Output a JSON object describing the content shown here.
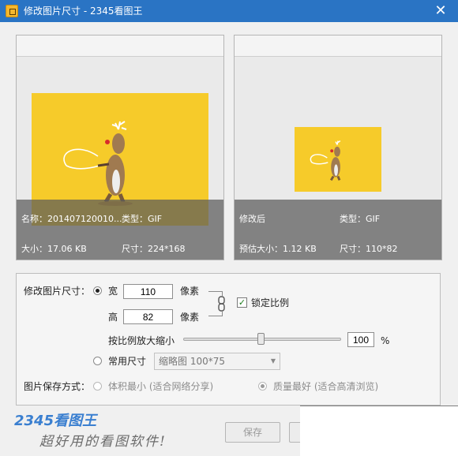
{
  "window": {
    "title": "修改图片尺寸 - 2345看图王",
    "close_symbol": "✕"
  },
  "preview_original": {
    "name_text": "名称：201407120010...",
    "type_text": "类型：GIF",
    "size_text": "大小：17.06 KB",
    "dimensions_text": "尺寸：224*168",
    "image_bg_color": "#f6cb2a"
  },
  "preview_modified": {
    "label_text": "修改后",
    "type_text": "类型：GIF",
    "est_size_text": "预估大小：1.12 KB",
    "dimensions_text": "尺寸：110*82",
    "image_bg_color": "#f6cb2a"
  },
  "settings": {
    "modify_label": "修改图片尺寸：",
    "width_label": "宽",
    "width_value": "110",
    "width_unit": "像素",
    "height_label": "高",
    "height_value": "82",
    "height_unit": "像素",
    "lock_label": "锁定比例",
    "lock_checked": true,
    "scale_label": "按比例放大缩小",
    "scale_value": "100",
    "scale_unit": "%",
    "scale_fraction": 0.49,
    "common_size_label": "常用尺寸",
    "common_size_selected": "缩略图 100*75",
    "save_mode_label": "图片保存方式：",
    "save_option_small": "体积最小 (适合网络分享)",
    "save_option_best": "质量最好 (适合高清浏览)",
    "save_option_best_selected": true
  },
  "buttons": {
    "save_label": "保存"
  },
  "branding": {
    "logo_text": "2345看图王",
    "slogan": "超好用的看图软件!",
    "logo_color": "#3a7fd0",
    "logo_accent_color": "#e8452c"
  },
  "colors": {
    "titlebar": "#2a74c4",
    "accent_yellow": "#f6cb2a"
  }
}
